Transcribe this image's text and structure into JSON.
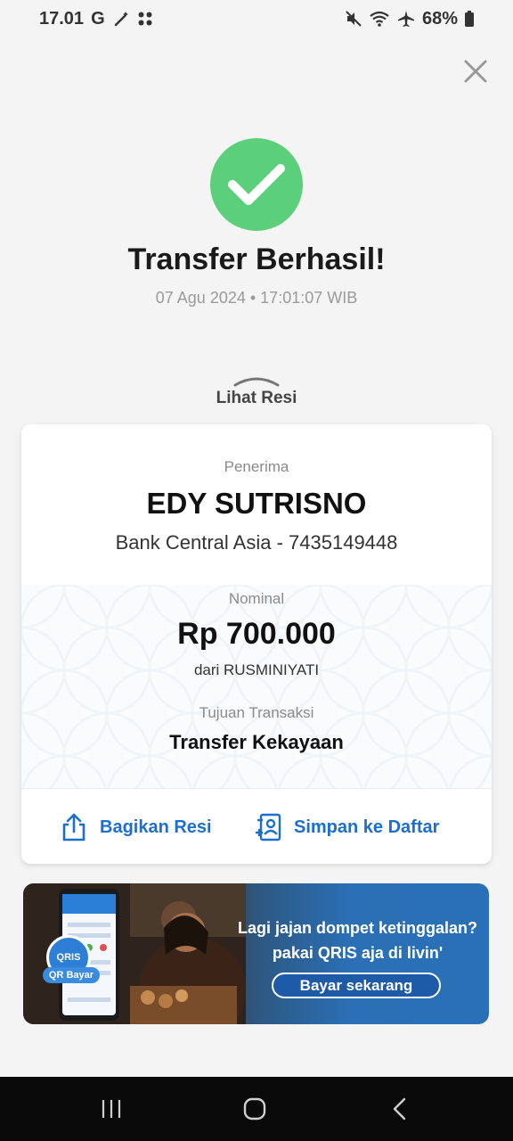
{
  "status_bar": {
    "time": "17.01",
    "network_letter": "G",
    "battery": "68%",
    "icons": [
      "magic-wand-icon",
      "apps-icon",
      "mute-icon",
      "wifi-icon",
      "airplane-icon",
      "battery-icon"
    ]
  },
  "header": {
    "title": "Transfer Berhasil!",
    "datetime": "07 Agu 2024 • 17:01:07 WIB",
    "close_icon": "close-icon",
    "success_icon": "check-circle-icon"
  },
  "receipt_toggle": {
    "label": "Lihat Resi",
    "icon": "chevron-up-icon"
  },
  "receipt": {
    "recipient_label": "Penerima",
    "recipient_name": "EDY SUTRISNO",
    "recipient_bank": "Bank Central Asia - 7435149448",
    "amount_label": "Nominal",
    "amount": "Rp 700.000",
    "sender": "dari RUSMINIYATI",
    "purpose_label": "Tujuan Transaksi",
    "purpose": "Transfer Kekayaan"
  },
  "actions": {
    "share_label": "Bagikan Resi",
    "save_label": "Simpan ke Daftar",
    "accent_color": "#1a6fd0"
  },
  "banner": {
    "line1": "Lagi jajan dompet ketinggalan?",
    "line2": "pakai QRIS aja di livin'",
    "cta": "Bayar sekarang",
    "qris_badge": "QRIS",
    "qr_label": "QR Bayar"
  },
  "colors": {
    "success": "#5ccf7a",
    "background": "#f4f4f4",
    "brand_blue": "#2b6fb4"
  }
}
